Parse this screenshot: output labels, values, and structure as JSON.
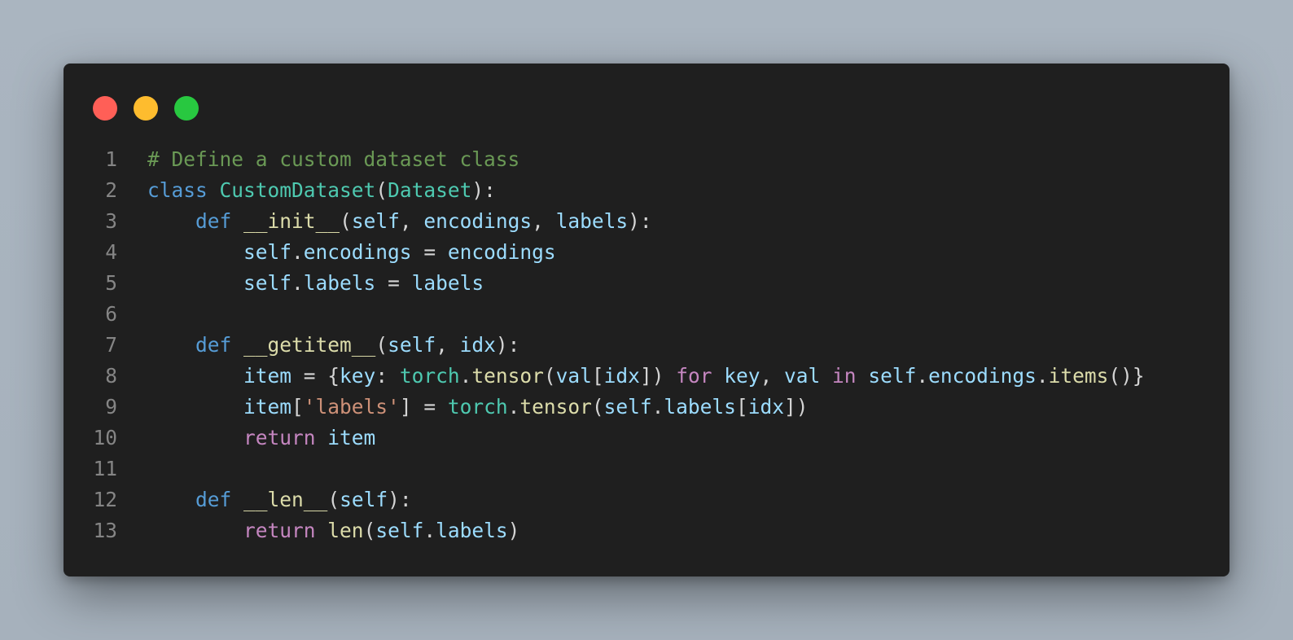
{
  "colors": {
    "page_background": "#a9b4bf",
    "window_background": "#1f1f1f",
    "close_dot": "#ff5f57",
    "minimize_dot": "#febc2e",
    "maximize_dot": "#28c840",
    "line_number": "#858585",
    "comment": "#6a9955",
    "keyword": "#569cd6",
    "control_keyword": "#c586c0",
    "class_name": "#4ec9b0",
    "function_name": "#dcdcaa",
    "variable": "#9cdcfe",
    "string": "#ce9178",
    "punctuation": "#d4d4d4"
  },
  "window_controls": [
    {
      "name": "close-dot",
      "color_key": "close_dot"
    },
    {
      "name": "minimize-dot",
      "color_key": "minimize_dot"
    },
    {
      "name": "maximize-dot",
      "color_key": "maximize_dot"
    }
  ],
  "code": {
    "language": "python",
    "lines": [
      {
        "number": "1",
        "tokens": [
          {
            "text": "# Define a custom dataset class",
            "type": "comment"
          }
        ]
      },
      {
        "number": "2",
        "tokens": [
          {
            "text": "class",
            "type": "kw"
          },
          {
            "text": " ",
            "type": "punct"
          },
          {
            "text": "CustomDataset",
            "type": "cls"
          },
          {
            "text": "(",
            "type": "punct"
          },
          {
            "text": "Dataset",
            "type": "cls"
          },
          {
            "text": "):",
            "type": "punct"
          }
        ]
      },
      {
        "number": "3",
        "tokens": [
          {
            "text": "    ",
            "type": "punct"
          },
          {
            "text": "def",
            "type": "kw"
          },
          {
            "text": " ",
            "type": "punct"
          },
          {
            "text": "__init__",
            "type": "fn"
          },
          {
            "text": "(",
            "type": "punct"
          },
          {
            "text": "self",
            "type": "var"
          },
          {
            "text": ", ",
            "type": "punct"
          },
          {
            "text": "encodings",
            "type": "var"
          },
          {
            "text": ", ",
            "type": "punct"
          },
          {
            "text": "labels",
            "type": "var"
          },
          {
            "text": "):",
            "type": "punct"
          }
        ]
      },
      {
        "number": "4",
        "tokens": [
          {
            "text": "        ",
            "type": "punct"
          },
          {
            "text": "self",
            "type": "var"
          },
          {
            "text": ".",
            "type": "punct"
          },
          {
            "text": "encodings",
            "type": "var"
          },
          {
            "text": " = ",
            "type": "punct"
          },
          {
            "text": "encodings",
            "type": "var"
          }
        ]
      },
      {
        "number": "5",
        "tokens": [
          {
            "text": "        ",
            "type": "punct"
          },
          {
            "text": "self",
            "type": "var"
          },
          {
            "text": ".",
            "type": "punct"
          },
          {
            "text": "labels",
            "type": "var"
          },
          {
            "text": " = ",
            "type": "punct"
          },
          {
            "text": "labels",
            "type": "var"
          }
        ]
      },
      {
        "number": "6",
        "tokens": []
      },
      {
        "number": "7",
        "tokens": [
          {
            "text": "    ",
            "type": "punct"
          },
          {
            "text": "def",
            "type": "kw"
          },
          {
            "text": " ",
            "type": "punct"
          },
          {
            "text": "__getitem__",
            "type": "fn"
          },
          {
            "text": "(",
            "type": "punct"
          },
          {
            "text": "self",
            "type": "var"
          },
          {
            "text": ", ",
            "type": "punct"
          },
          {
            "text": "idx",
            "type": "var"
          },
          {
            "text": "):",
            "type": "punct"
          }
        ]
      },
      {
        "number": "8",
        "tokens": [
          {
            "text": "        ",
            "type": "punct"
          },
          {
            "text": "item",
            "type": "var"
          },
          {
            "text": " = {",
            "type": "punct"
          },
          {
            "text": "key",
            "type": "var"
          },
          {
            "text": ": ",
            "type": "punct"
          },
          {
            "text": "torch",
            "type": "cls"
          },
          {
            "text": ".",
            "type": "punct"
          },
          {
            "text": "tensor",
            "type": "fn"
          },
          {
            "text": "(",
            "type": "punct"
          },
          {
            "text": "val",
            "type": "var"
          },
          {
            "text": "[",
            "type": "punct"
          },
          {
            "text": "idx",
            "type": "var"
          },
          {
            "text": "]) ",
            "type": "punct"
          },
          {
            "text": "for",
            "type": "ctrl"
          },
          {
            "text": " ",
            "type": "punct"
          },
          {
            "text": "key",
            "type": "var"
          },
          {
            "text": ", ",
            "type": "punct"
          },
          {
            "text": "val",
            "type": "var"
          },
          {
            "text": " ",
            "type": "punct"
          },
          {
            "text": "in",
            "type": "ctrl"
          },
          {
            "text": " ",
            "type": "punct"
          },
          {
            "text": "self",
            "type": "var"
          },
          {
            "text": ".",
            "type": "punct"
          },
          {
            "text": "encodings",
            "type": "var"
          },
          {
            "text": ".",
            "type": "punct"
          },
          {
            "text": "items",
            "type": "fn"
          },
          {
            "text": "()}",
            "type": "punct"
          }
        ]
      },
      {
        "number": "9",
        "tokens": [
          {
            "text": "        ",
            "type": "punct"
          },
          {
            "text": "item",
            "type": "var"
          },
          {
            "text": "[",
            "type": "punct"
          },
          {
            "text": "'labels'",
            "type": "str"
          },
          {
            "text": "] = ",
            "type": "punct"
          },
          {
            "text": "torch",
            "type": "cls"
          },
          {
            "text": ".",
            "type": "punct"
          },
          {
            "text": "tensor",
            "type": "fn"
          },
          {
            "text": "(",
            "type": "punct"
          },
          {
            "text": "self",
            "type": "var"
          },
          {
            "text": ".",
            "type": "punct"
          },
          {
            "text": "labels",
            "type": "var"
          },
          {
            "text": "[",
            "type": "punct"
          },
          {
            "text": "idx",
            "type": "var"
          },
          {
            "text": "])",
            "type": "punct"
          }
        ]
      },
      {
        "number": "10",
        "tokens": [
          {
            "text": "        ",
            "type": "punct"
          },
          {
            "text": "return",
            "type": "ctrl"
          },
          {
            "text": " ",
            "type": "punct"
          },
          {
            "text": "item",
            "type": "var"
          }
        ]
      },
      {
        "number": "11",
        "tokens": []
      },
      {
        "number": "12",
        "tokens": [
          {
            "text": "    ",
            "type": "punct"
          },
          {
            "text": "def",
            "type": "kw"
          },
          {
            "text": " ",
            "type": "punct"
          },
          {
            "text": "__len__",
            "type": "fn"
          },
          {
            "text": "(",
            "type": "punct"
          },
          {
            "text": "self",
            "type": "var"
          },
          {
            "text": "):",
            "type": "punct"
          }
        ]
      },
      {
        "number": "13",
        "tokens": [
          {
            "text": "        ",
            "type": "punct"
          },
          {
            "text": "return",
            "type": "ctrl"
          },
          {
            "text": " ",
            "type": "punct"
          },
          {
            "text": "len",
            "type": "fn"
          },
          {
            "text": "(",
            "type": "punct"
          },
          {
            "text": "self",
            "type": "var"
          },
          {
            "text": ".",
            "type": "punct"
          },
          {
            "text": "labels",
            "type": "var"
          },
          {
            "text": ")",
            "type": "punct"
          }
        ]
      }
    ]
  }
}
